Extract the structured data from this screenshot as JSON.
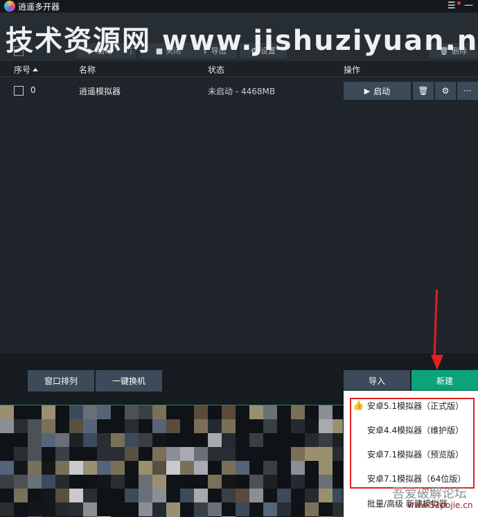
{
  "app": {
    "title": "逍遥多开器"
  },
  "watermark": "技术资源网 www.jishuziyuan.n",
  "toolbar": {
    "start_label": "启动",
    "close_label": "关闭",
    "export_label": "导出",
    "settings_label": "设置",
    "delete_label": "删除"
  },
  "table": {
    "columns": {
      "index": "序号",
      "name": "名称",
      "status": "状态",
      "ops": "操作"
    },
    "rows": [
      {
        "index": "0",
        "name": "逍遥模拟器",
        "status": "未启动 - 4468MB",
        "start_label": "启动"
      }
    ]
  },
  "footer": {
    "arrange_label": "窗口排列",
    "switch_label": "一键换机",
    "import_label": "导入",
    "new_label": "新建"
  },
  "dropdown": {
    "items": [
      "安卓5.1模拟器（正式版）",
      "安卓4.4模拟器（维护版）",
      "安卓7.1模拟器（预览版）",
      "安卓7.1模拟器（64位版）",
      "批量/高级 新建模拟器"
    ]
  },
  "overlay": {
    "site_name": "吾爱破解论坛",
    "site_url": "www.52pojie.cn"
  },
  "colors": {
    "accent_green": "#0da37a",
    "button_blue": "#3b4b59",
    "highlight_red": "#e02020"
  },
  "icons": [
    "app-logo-icon",
    "menu-icon",
    "minimize-icon",
    "play-icon",
    "stop-icon",
    "export-icon",
    "gear-icon",
    "trash-icon",
    "more-icon",
    "thumbs-up-icon",
    "sort-asc-icon"
  ]
}
